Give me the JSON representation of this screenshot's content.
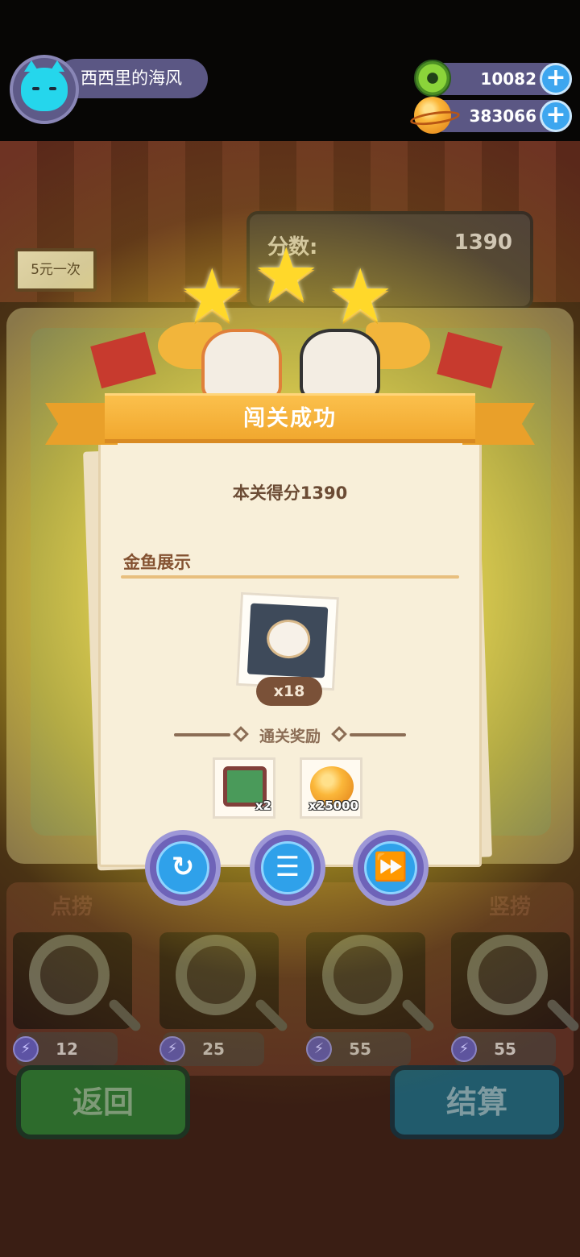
{
  "player": {
    "name": "西西里的海风",
    "avatar_icon": "blue-cat-avatar-icon"
  },
  "currencies": [
    {
      "icon": "green-token-icon",
      "value": "10082",
      "add_label": "+"
    },
    {
      "icon": "gold-planet-coin-icon",
      "value": "383066",
      "add_label": "+"
    }
  ],
  "background": {
    "sign": "5元一次",
    "score_label": "分数:",
    "score_value": "1390",
    "tools": [
      {
        "title": "点捞",
        "cost": "12"
      },
      {
        "title": "",
        "cost": "25"
      },
      {
        "title": "",
        "cost": "55"
      },
      {
        "title": "竖捞",
        "cost": "55"
      }
    ],
    "back_label": "返回",
    "settle_label": "结算"
  },
  "modal": {
    "stars": 3,
    "banner": "闯关成功",
    "score_text": "本关得分1390",
    "section_title": "金鱼展示",
    "fish_count": "x18",
    "rewards_title": "通关奖励",
    "rewards": [
      {
        "icon": "chip-card-icon",
        "count": "x2"
      },
      {
        "icon": "gold-coin-icon",
        "count": "x25000"
      }
    ],
    "actions": [
      {
        "name": "replay-button",
        "icon": "refresh-icon"
      },
      {
        "name": "list-button",
        "icon": "list-icon"
      },
      {
        "name": "next-button",
        "icon": "fast-forward-icon"
      }
    ]
  }
}
